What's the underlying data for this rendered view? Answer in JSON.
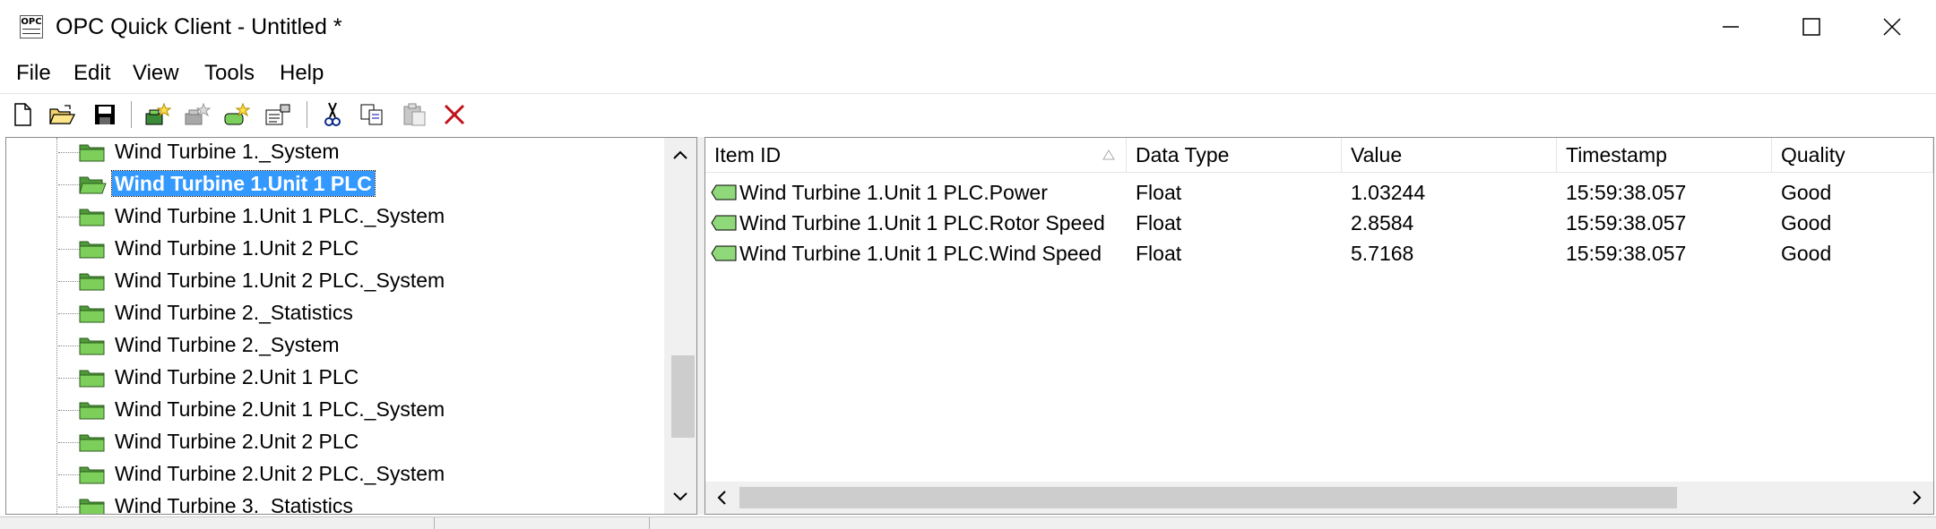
{
  "window": {
    "title": "OPC Quick Client - Untitled *",
    "app_icon_text": "OPC"
  },
  "menu": [
    "File",
    "Edit",
    "View",
    "Tools",
    "Help"
  ],
  "toolbar": [
    "new-file",
    "open-file",
    "save",
    "new-server-connection",
    "new-group",
    "new-item",
    "properties",
    "cut",
    "copy",
    "paste",
    "delete"
  ],
  "tree": {
    "items": [
      {
        "label": "Wind Turbine 1._System",
        "selected": false
      },
      {
        "label": "Wind Turbine 1.Unit 1 PLC",
        "selected": true
      },
      {
        "label": "Wind Turbine 1.Unit 1 PLC._System",
        "selected": false
      },
      {
        "label": "Wind Turbine 1.Unit 2 PLC",
        "selected": false
      },
      {
        "label": "Wind Turbine 1.Unit 2 PLC._System",
        "selected": false
      },
      {
        "label": "Wind Turbine 2._Statistics",
        "selected": false
      },
      {
        "label": "Wind Turbine 2._System",
        "selected": false
      },
      {
        "label": "Wind Turbine 2.Unit 1 PLC",
        "selected": false
      },
      {
        "label": "Wind Turbine 2.Unit 1 PLC._System",
        "selected": false
      },
      {
        "label": "Wind Turbine 2.Unit 2 PLC",
        "selected": false
      },
      {
        "label": "Wind Turbine 2.Unit 2 PLC._System",
        "selected": false
      },
      {
        "label": "Wind Turbine 3._Statistics",
        "selected": false
      }
    ]
  },
  "list": {
    "columns": [
      "Item ID",
      "Data Type",
      "Value",
      "Timestamp",
      "Quality"
    ],
    "sort_column": "Item ID",
    "rows": [
      {
        "item_id": "Wind Turbine 1.Unit 1 PLC.Power",
        "data_type": "Float",
        "value": "1.03244",
        "timestamp": "15:59:38.057",
        "quality": "Good"
      },
      {
        "item_id": "Wind Turbine 1.Unit 1 PLC.Rotor Speed",
        "data_type": "Float",
        "value": "2.8584",
        "timestamp": "15:59:38.057",
        "quality": "Good"
      },
      {
        "item_id": "Wind Turbine 1.Unit 1 PLC.Wind Speed",
        "data_type": "Float",
        "value": "5.7168",
        "timestamp": "15:59:38.057",
        "quality": "Good"
      }
    ]
  },
  "colors": {
    "selection": "#3399ff",
    "folder": "#7ccf5a",
    "tag": "#8fd97a"
  }
}
